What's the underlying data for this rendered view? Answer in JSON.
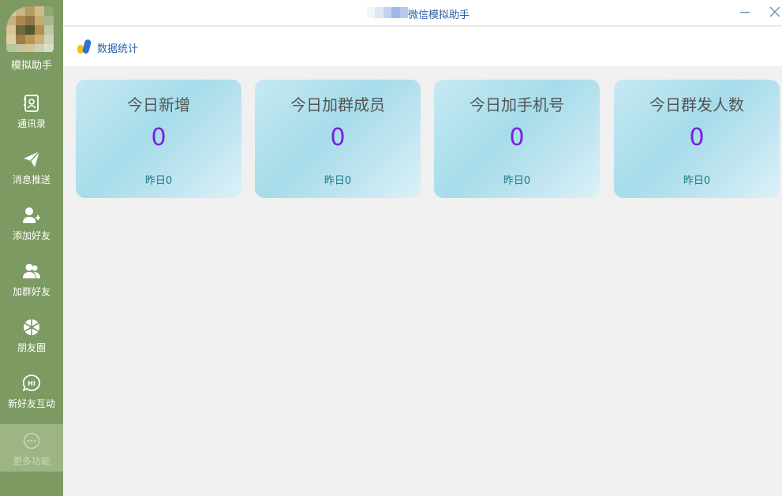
{
  "app": {
    "name": "模拟助手",
    "window_title": "微信模拟助手"
  },
  "sidebar": {
    "items": [
      {
        "label": "通讯录",
        "icon": "contacts-icon"
      },
      {
        "label": "消息推送",
        "icon": "send-icon"
      },
      {
        "label": "添加好友",
        "icon": "add-user-icon"
      },
      {
        "label": "加群好友",
        "icon": "group-icon"
      },
      {
        "label": "朋友圈",
        "icon": "moments-icon"
      },
      {
        "label": "新好友互动",
        "icon": "hi-chat-icon"
      },
      {
        "label": "更多功能",
        "icon": "more-icon",
        "active": true
      }
    ]
  },
  "window_controls": {
    "minimize": "minimize-icon",
    "close": "close-icon"
  },
  "header": {
    "title": "数据统计",
    "icon": "stats-icon"
  },
  "cards": [
    {
      "title": "今日新增",
      "value": "0",
      "yesterday": "昨日0"
    },
    {
      "title": "今日加群成员",
      "value": "0",
      "yesterday": "昨日0"
    },
    {
      "title": "今日加手机号",
      "value": "0",
      "yesterday": "昨日0"
    },
    {
      "title": "今日群发人数",
      "value": "0",
      "yesterday": "昨日0"
    }
  ],
  "colors": {
    "sidebar_bg": "#7c9a62",
    "accent_blue": "#2b5fa8",
    "value_purple": "#7d1ee0",
    "foot_teal": "#1b7a86"
  }
}
